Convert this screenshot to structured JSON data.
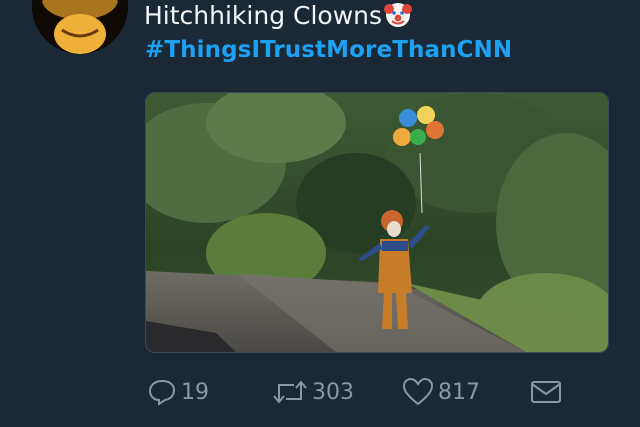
{
  "tweet": {
    "display_name": "Hitchhiking Clowns",
    "name_emoji": "clown-face-emoji",
    "text": "#ThingsITrustMoreThanCNN",
    "media_description": "photo",
    "colors": {
      "background": "#1b2836",
      "hashtag": "#1da1f2",
      "icons": "#8899a6",
      "name": "#f2f4f6"
    }
  },
  "actions": {
    "reply": {
      "icon": "reply-bubble-icon",
      "count": "19"
    },
    "retweet": {
      "icon": "retweet-icon",
      "count": "303"
    },
    "like": {
      "icon": "heart-icon",
      "count": "817"
    },
    "dm": {
      "icon": "envelope-icon"
    }
  }
}
